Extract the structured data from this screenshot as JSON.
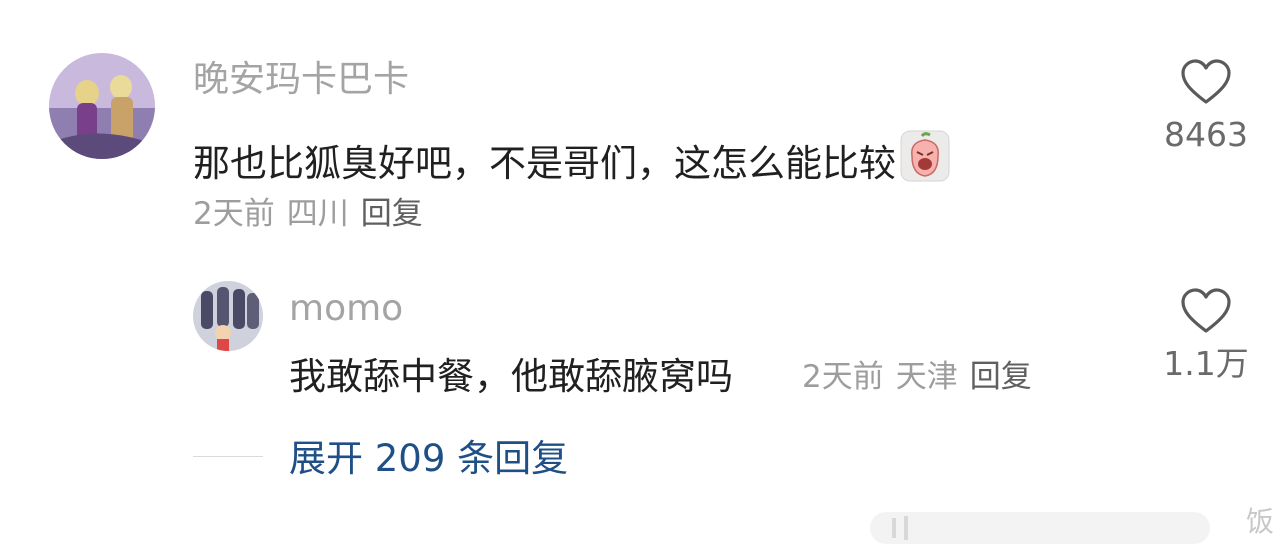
{
  "comments": [
    {
      "username": "晚安玛卡巴卡",
      "text": "那也比狐臭好吧，不是哥们，这怎么能比较",
      "emoji_icon": "crying-face-sticker",
      "time": "2天前",
      "location": "四川",
      "reply_label": "回复",
      "like_count": "8463"
    },
    {
      "username": "momo",
      "text": "我敢舔中餐，他敢舔腋窝吗",
      "time": "2天前",
      "location": "天津",
      "reply_label": "回复",
      "like_count": "1.1万"
    }
  ],
  "expand_replies": "展开 209 条回复",
  "watermark": "饭",
  "colors": {
    "username": "#a4a4a4",
    "text": "#202020",
    "meta": "#9d9d9d",
    "link": "#1e4f86"
  }
}
